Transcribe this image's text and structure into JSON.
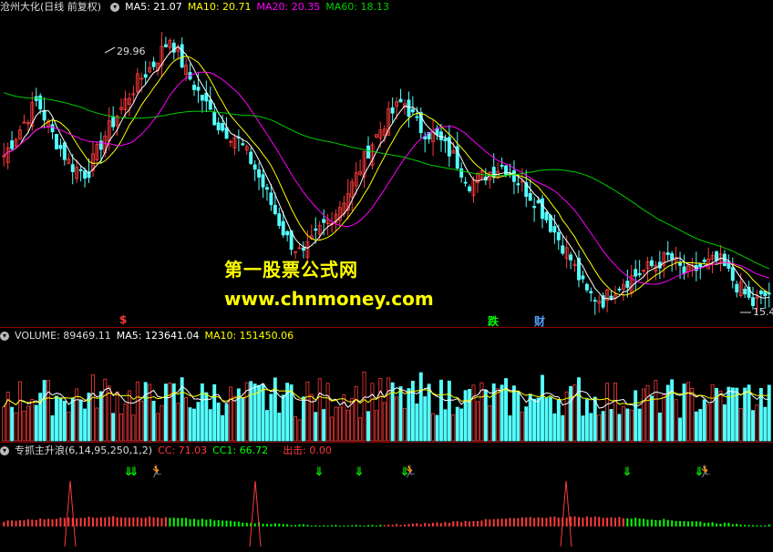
{
  "price_panel": {
    "title": "沧州大化(日线 前复权)",
    "ma5_label": "MA5: 21.07",
    "ma10_label": "MA10: 20.71",
    "ma20_label": "MA20: 20.35",
    "ma60_label": "MA60: 18.13",
    "high_label": "29.96",
    "low_label": "15.4",
    "tag_s": "$",
    "tag_die": "跌",
    "tag_cai": "财",
    "watermark_name": "第一股票公式网",
    "watermark_url": "www.chnmoney.com",
    "colors": {
      "up": "#ff3b3b",
      "down": "#54ffff",
      "ma5": "#ffffff",
      "ma10": "#ffff00",
      "ma20": "#ff00ff",
      "ma60": "#00cc00"
    }
  },
  "volume_panel": {
    "title": "VOLUME: 89469.11",
    "ma5_label": "MA5: 123641.04",
    "ma10_label": "MA10: 151450.06"
  },
  "indicator_panel": {
    "title": "专抓主升浪(6,14,95,250,1,2)",
    "cc_label": "CC: 71.03",
    "cc1_label": "CC1: 66.72",
    "exit_label": "出击: 0.00",
    "colors": {
      "title": "#dddddd",
      "cc": "#ff3b3b",
      "cc1": "#00ff00",
      "exit": "#ff3b3b"
    }
  },
  "chart_data": [
    {
      "type": "candlestick",
      "title": "沧州大化(日线 前复权)",
      "series": [
        {
          "name": "MA5",
          "last": 21.07
        },
        {
          "name": "MA10",
          "last": 20.71
        },
        {
          "name": "MA20",
          "last": 20.35
        },
        {
          "name": "MA60",
          "last": 18.13
        }
      ],
      "annotations": [
        {
          "text": "29.96",
          "kind": "high"
        },
        {
          "text": "15.4",
          "kind": "low"
        }
      ],
      "price_path": [
        23.5,
        25.0,
        26.5,
        24.5,
        23.0,
        22.5,
        24.5,
        26.0,
        27.5,
        28.5,
        29.96,
        28.0,
        26.5,
        25.0,
        24.5,
        23.0,
        21.0,
        19.0,
        18.0,
        19.5,
        20.5,
        22.0,
        24.0,
        25.5,
        26.5,
        25.0,
        24.5,
        23.5,
        22.0,
        22.5,
        23.0,
        22.0,
        21.0,
        19.5,
        18.0,
        16.0,
        15.6,
        16.5,
        17.0,
        17.5,
        18.0,
        17.0,
        17.5,
        17.8,
        16.5,
        15.4,
        16.0
      ],
      "ylim": [
        14.5,
        31.0
      ],
      "grid": false
    },
    {
      "type": "bar",
      "title": "VOLUME: 89469.11",
      "series": [
        {
          "name": "VOLUME",
          "last": 89469.11
        },
        {
          "name": "MA5",
          "last": 123641.04
        },
        {
          "name": "MA10",
          "last": 151450.06
        }
      ],
      "ylim": [
        0,
        280000
      ]
    },
    {
      "type": "line",
      "title": "专抓主升浪(6,14,95,250,1,2)",
      "series": [
        {
          "name": "CC",
          "last": 71.03
        },
        {
          "name": "CC1",
          "last": 66.72
        },
        {
          "name": "出击",
          "last": 0.0
        }
      ],
      "spike_count": 3
    }
  ]
}
